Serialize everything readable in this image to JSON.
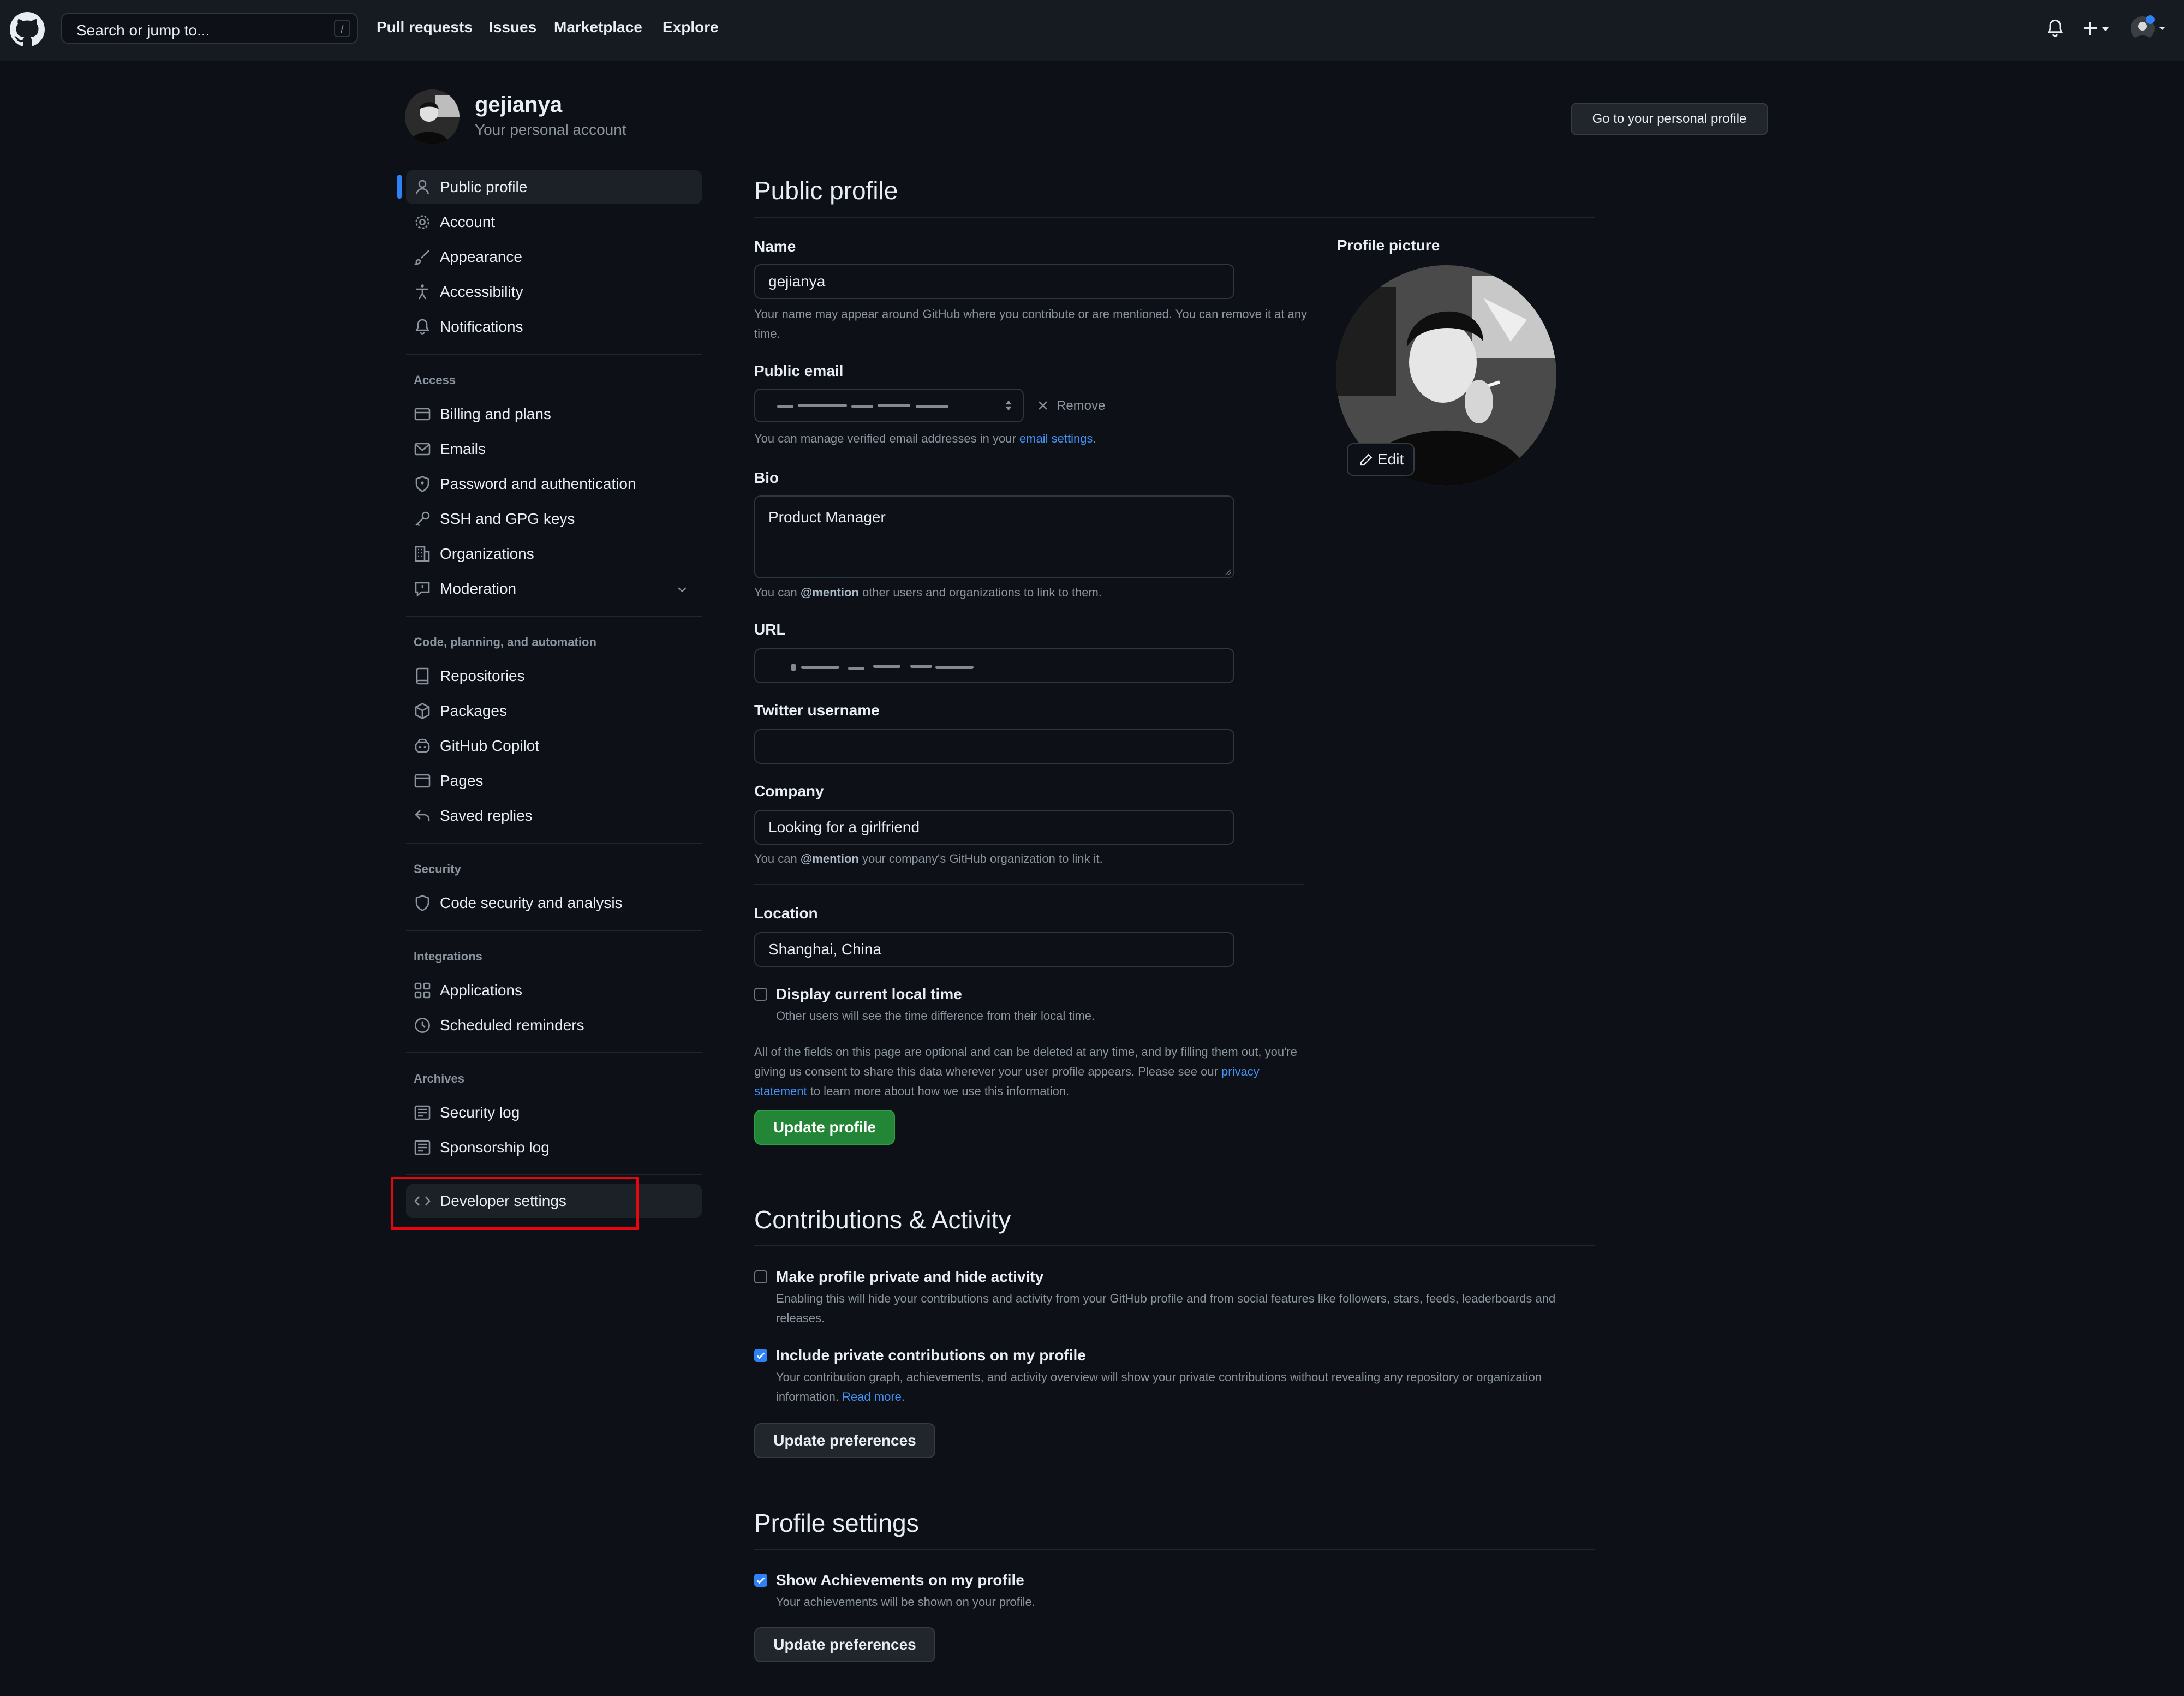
{
  "topbar": {
    "search_placeholder": "Search or jump to...",
    "search_shortcut": "/",
    "nav": [
      "Pull requests",
      "Issues",
      "Marketplace",
      "Explore"
    ]
  },
  "header": {
    "username": "gejianya",
    "subtitle": "Your personal account",
    "go_profile_button": "Go to your personal profile"
  },
  "sidebar": {
    "main_items": [
      "Public profile",
      "Account",
      "Appearance",
      "Accessibility",
      "Notifications"
    ],
    "access_heading": "Access",
    "access_items": [
      "Billing and plans",
      "Emails",
      "Password and authentication",
      "SSH and GPG keys",
      "Organizations",
      "Moderation"
    ],
    "code_heading": "Code, planning, and automation",
    "code_items": [
      "Repositories",
      "Packages",
      "GitHub Copilot",
      "Pages",
      "Saved replies"
    ],
    "security_heading": "Security",
    "security_items": [
      "Code security and analysis"
    ],
    "integrations_heading": "Integrations",
    "integrations_items": [
      "Applications",
      "Scheduled reminders"
    ],
    "archives_heading": "Archives",
    "archives_items": [
      "Security log",
      "Sponsorship log"
    ],
    "developer_settings": "Developer settings"
  },
  "public_profile": {
    "title": "Public profile",
    "name_label": "Name",
    "name_value": "gejianya",
    "name_note": "Your name may appear around GitHub where you contribute or are mentioned. You can remove it at any time.",
    "email_label": "Public email",
    "email_remove": "Remove",
    "email_note_prefix": "You can manage verified email addresses in your ",
    "email_note_link": "email settings",
    "email_note_suffix": ".",
    "bio_label": "Bio",
    "bio_value": "Product Manager",
    "bio_note_prefix": "You can ",
    "bio_note_mention": "@mention",
    "bio_note_suffix": " other users and organizations to link to them.",
    "url_label": "URL",
    "twitter_label": "Twitter username",
    "twitter_value": "",
    "company_label": "Company",
    "company_value": "Looking for a girlfriend",
    "company_note_prefix": "You can ",
    "company_note_mention": "@mention",
    "company_note_suffix": " your company's GitHub organization to link it.",
    "location_label": "Location",
    "location_value": "Shanghai, China",
    "local_time_label": "Display current local time",
    "local_time_note": "Other users will see the time difference from their local time.",
    "local_time_checked": false,
    "legal_note_1": "All of the fields on this page are optional and can be deleted at any time, and by filling them out, you're giving us consent to share this data wherever your user profile appears. Please see our ",
    "legal_note_link": "privacy statement",
    "legal_note_2": " to learn more about how we use this information.",
    "update_button": "Update profile",
    "picture_label": "Profile picture",
    "edit_button": "Edit"
  },
  "contributions": {
    "title": "Contributions & Activity",
    "private_label": "Make profile private and hide activity",
    "private_note": "Enabling this will hide your contributions and activity from your GitHub profile and from social features like followers, stars, feeds, leaderboards and releases.",
    "private_checked": false,
    "include_label": "Include private contributions on my profile",
    "include_note": "Your contribution graph, achievements, and activity overview will show your private contributions without revealing any repository or organization information. ",
    "include_link": "Read more.",
    "include_checked": true,
    "update_button": "Update preferences"
  },
  "profile_settings": {
    "title": "Profile settings",
    "achievements_label": "Show Achievements on my profile",
    "achievements_note": "Your achievements will be shown on your profile.",
    "achievements_checked": true,
    "update_button": "Update preferences"
  },
  "colors": {
    "background": "#0d1117",
    "accent": "#2f81f7",
    "primary_button": "#238636",
    "highlight": "#e5060f"
  }
}
